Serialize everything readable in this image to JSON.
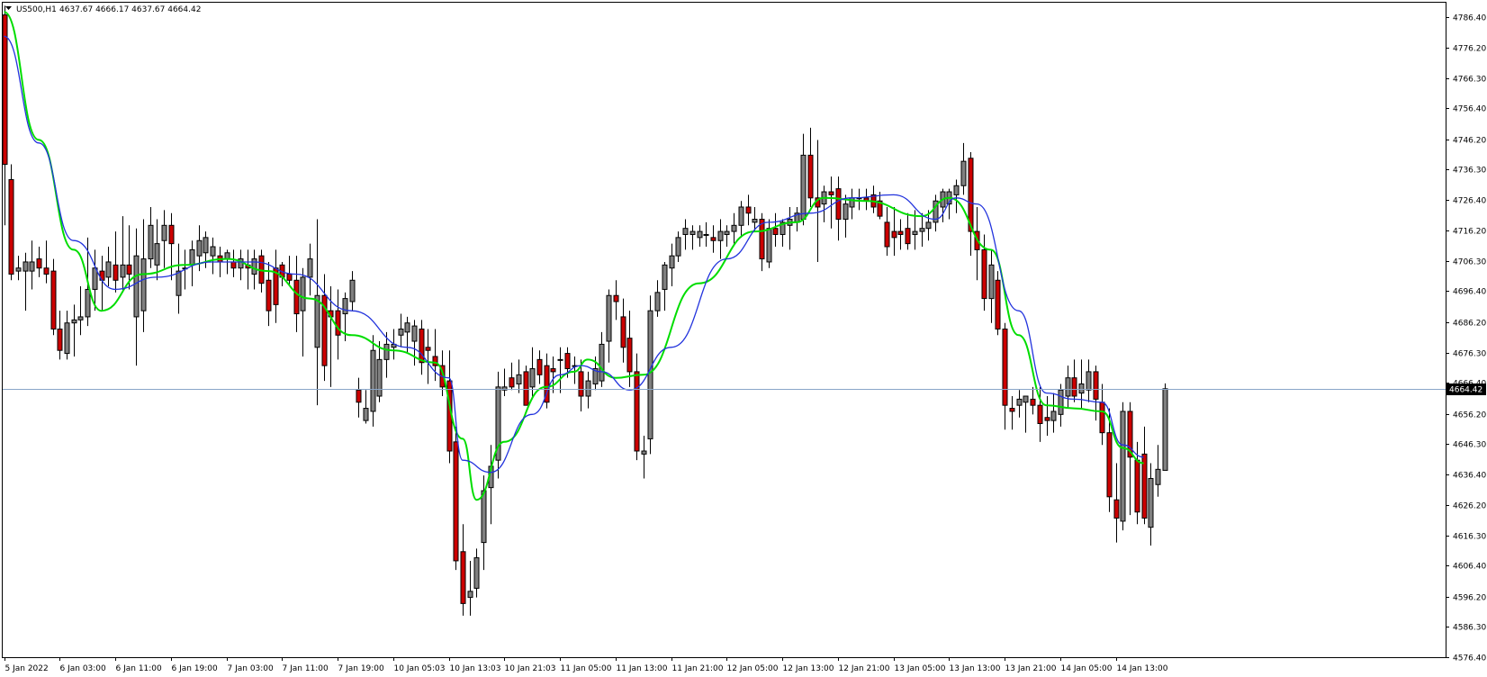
{
  "window": {
    "symbol_title": "US500,H1",
    "ohlc_text": "4637.67 4666.17 4637.67 4664.42"
  },
  "current_price_label": "4664.42",
  "colors": {
    "bull_body": "#808080",
    "bear_body": "#cc0000",
    "ma_fast": "#2233dd",
    "ma_slow": "#00dd00",
    "price_line": "#8aa6c8",
    "frame": "#000000"
  },
  "chart_data": {
    "type": "candlestick",
    "symbol": "US500",
    "timeframe": "H1",
    "ylim": [
      4576.4,
      4791.0
    ],
    "y_ticks": [
      "4786.40",
      "4776.20",
      "4766.30",
      "4756.40",
      "4746.20",
      "4736.30",
      "4726.40",
      "4716.20",
      "4706.30",
      "4696.40",
      "4686.20",
      "4676.30",
      "4666.40",
      "4656.20",
      "4646.30",
      "4636.40",
      "4626.20",
      "4616.30",
      "4606.40",
      "4596.20",
      "4586.30",
      "4576.40"
    ],
    "x_tick_labels": [
      "5 Jan 2022",
      "6 Jan 03:00",
      "6 Jan 11:00",
      "6 Jan 19:00",
      "7 Jan 03:00",
      "7 Jan 11:00",
      "7 Jan 19:00",
      "10 Jan 05:03",
      "10 Jan 13:03",
      "10 Jan 21:03",
      "11 Jan 05:00",
      "11 Jan 13:00",
      "11 Jan 21:00",
      "12 Jan 05:00",
      "12 Jan 13:00",
      "12 Jan 21:00",
      "13 Jan 05:00",
      "13 Jan 13:00",
      "13 Jan 21:00",
      "14 Jan 05:00",
      "14 Jan 13:00"
    ],
    "x_tick_bar_index": [
      0,
      8,
      16,
      24,
      32,
      40,
      48,
      56,
      64,
      72,
      80,
      88,
      96,
      104,
      112,
      120,
      128,
      136,
      144,
      152,
      160
    ],
    "current_price": 4664.42,
    "candles": [
      [
        4787,
        4790,
        4718,
        4738
      ],
      [
        4733,
        4738,
        4700,
        4702
      ],
      [
        4703,
        4708,
        4700,
        4704
      ],
      [
        4703,
        4709,
        4690,
        4706
      ],
      [
        4703,
        4713,
        4697,
        4706
      ],
      [
        4707,
        4711,
        4701,
        4704
      ],
      [
        4704,
        4713,
        4699,
        4702
      ],
      [
        4703,
        4707,
        4682,
        4684
      ],
      [
        4684,
        4690,
        4674,
        4677
      ],
      [
        4676,
        4690,
        4674,
        4686
      ],
      [
        4686,
        4692,
        4675,
        4687
      ],
      [
        4687,
        4698,
        4682,
        4688
      ],
      [
        4688,
        4714,
        4685,
        4697
      ],
      [
        4697,
        4710,
        4690,
        4704
      ],
      [
        4703,
        4708,
        4690,
        4700
      ],
      [
        4701,
        4711,
        4698,
        4706
      ],
      [
        4705,
        4716,
        4696,
        4700
      ],
      [
        4701,
        4721,
        4696,
        4705
      ],
      [
        4705,
        4718,
        4697,
        4702
      ],
      [
        4688,
        4717,
        4672,
        4708
      ],
      [
        4690,
        4720,
        4683,
        4707
      ],
      [
        4707,
        4724,
        4704,
        4718
      ],
      [
        4705,
        4720,
        4700,
        4712
      ],
      [
        4713,
        4723,
        4704,
        4718
      ],
      [
        4718,
        4722,
        4700,
        4712
      ],
      [
        4695,
        4712,
        4689,
        4703
      ],
      [
        4704,
        4710,
        4697,
        4704
      ],
      [
        4705,
        4713,
        4698,
        4710
      ],
      [
        4708,
        4718,
        4703,
        4713
      ],
      [
        4709,
        4716,
        4704,
        4714
      ],
      [
        4708,
        4714,
        4702,
        4711
      ],
      [
        4708,
        4711,
        4701,
        4706
      ],
      [
        4707,
        4710,
        4702,
        4709
      ],
      [
        4706,
        4710,
        4701,
        4704
      ],
      [
        4704,
        4710,
        4700,
        4707
      ],
      [
        4705,
        4710,
        4697,
        4704
      ],
      [
        4702,
        4710,
        4697,
        4707
      ],
      [
        4708,
        4710,
        4696,
        4699
      ],
      [
        4700,
        4706,
        4685,
        4690
      ],
      [
        4704,
        4710,
        4686,
        4692
      ],
      [
        4705,
        4706,
        4698,
        4701
      ],
      [
        4702,
        4708,
        4698,
        4700
      ],
      [
        4700,
        4708,
        4683,
        4689
      ],
      [
        4690,
        4704,
        4675,
        4701
      ],
      [
        4701,
        4712,
        4695,
        4707
      ],
      [
        4678,
        4720,
        4659,
        4695
      ],
      [
        4695,
        4702,
        4667,
        4672
      ],
      [
        4690,
        4698,
        4665,
        4688
      ],
      [
        4690,
        4697,
        4674,
        4682
      ],
      [
        4689,
        4696,
        4680,
        4694
      ],
      [
        4693,
        4703,
        4690,
        4700
      ],
      [
        4664,
        4668,
        4655,
        4660
      ],
      [
        4654,
        4664,
        4653,
        4658
      ],
      [
        4657,
        4682,
        4652,
        4677
      ],
      [
        4662,
        4680,
        4660,
        4674
      ],
      [
        4674,
        4683,
        4668,
        4679
      ],
      [
        4678,
        4684,
        4674,
        4679
      ],
      [
        4682,
        4689,
        4678,
        4684
      ],
      [
        4683,
        4688,
        4676,
        4686
      ],
      [
        4680,
        4687,
        4672,
        4685
      ],
      [
        4684,
        4687,
        4669,
        4673
      ],
      [
        4678,
        4684,
        4666,
        4677
      ],
      [
        4675,
        4684,
        4667,
        4672
      ],
      [
        4672,
        4677,
        4662,
        4665
      ],
      [
        4667,
        4677,
        4640,
        4644
      ],
      [
        4647,
        4652,
        4605,
        4608
      ],
      [
        4611,
        4620,
        4590,
        4594
      ],
      [
        4596,
        4608,
        4590,
        4598
      ],
      [
        4599,
        4612,
        4596,
        4609
      ],
      [
        4614,
        4636,
        4605,
        4631
      ],
      [
        4632,
        4646,
        4620,
        4639
      ],
      [
        4641,
        4670,
        4635,
        4665
      ],
      [
        4664,
        4671,
        4662,
        4665
      ],
      [
        4668,
        4673,
        4664,
        4665
      ],
      [
        4666,
        4674,
        4663,
        4669
      ],
      [
        4670,
        4672,
        4660,
        4659
      ],
      [
        4665,
        4678,
        4661,
        4671
      ],
      [
        4674,
        4677,
        4666,
        4669
      ],
      [
        4672,
        4676,
        4658,
        4660
      ],
      [
        4671,
        4675,
        4663,
        4670
      ],
      [
        4674,
        4678,
        4663,
        4674
      ],
      [
        4676,
        4678,
        4668,
        4671
      ],
      [
        4672,
        4675,
        4666,
        4672
      ],
      [
        4670,
        4674,
        4657,
        4662
      ],
      [
        4662,
        4670,
        4658,
        4667
      ],
      [
        4666,
        4675,
        4664,
        4671
      ],
      [
        4667,
        4683,
        4665,
        4679
      ],
      [
        4680,
        4697,
        4673,
        4695
      ],
      [
        4695,
        4700,
        4687,
        4693
      ],
      [
        4688,
        4694,
        4673,
        4678
      ],
      [
        4681,
        4690,
        4665,
        4670
      ],
      [
        4670,
        4676,
        4641,
        4644
      ],
      [
        4643,
        4649,
        4635,
        4644
      ],
      [
        4648,
        4695,
        4643,
        4690
      ],
      [
        4690,
        4700,
        4688,
        4696
      ],
      [
        4697,
        4706,
        4690,
        4705
      ],
      [
        4704,
        4712,
        4698,
        4708
      ],
      [
        4708,
        4716,
        4706,
        4714
      ],
      [
        4715,
        4720,
        4710,
        4717
      ],
      [
        4715,
        4718,
        4710,
        4716
      ],
      [
        4714,
        4718,
        4711,
        4716
      ],
      [
        4715,
        4719,
        4711,
        4715
      ],
      [
        4714,
        4718,
        4709,
        4713
      ],
      [
        4713,
        4720,
        4707,
        4716
      ],
      [
        4715,
        4718,
        4711,
        4716
      ],
      [
        4716,
        4722,
        4712,
        4718
      ],
      [
        4718,
        4726,
        4714,
        4724
      ],
      [
        4724,
        4728,
        4718,
        4722
      ],
      [
        4719,
        4724,
        4716,
        4720
      ],
      [
        4720,
        4722,
        4703,
        4707
      ],
      [
        4706,
        4720,
        4704,
        4717
      ],
      [
        4717,
        4722,
        4711,
        4715
      ],
      [
        4715,
        4720,
        4711,
        4719
      ],
      [
        4718,
        4724,
        4710,
        4720
      ],
      [
        4719,
        4724,
        4716,
        4722
      ],
      [
        4720,
        4748,
        4718,
        4741
      ],
      [
        4741,
        4750,
        4724,
        4727
      ],
      [
        4727,
        4746,
        4706,
        4724
      ],
      [
        4725,
        4731,
        4719,
        4729
      ],
      [
        4729,
        4734,
        4717,
        4728
      ],
      [
        4730,
        4734,
        4713,
        4720
      ],
      [
        4720,
        4728,
        4714,
        4725
      ],
      [
        4724,
        4730,
        4720,
        4727
      ],
      [
        4727,
        4730,
        4723,
        4727
      ],
      [
        4727,
        4730,
        4723,
        4726
      ],
      [
        4728,
        4731,
        4722,
        4724
      ],
      [
        4726,
        4729,
        4720,
        4721
      ],
      [
        4719,
        4724,
        4708,
        4711
      ],
      [
        4716,
        4724,
        4708,
        4714
      ],
      [
        4716,
        4720,
        4710,
        4715
      ],
      [
        4717,
        4722,
        4710,
        4712
      ],
      [
        4715,
        4723,
        4710,
        4716
      ],
      [
        4716,
        4722,
        4711,
        4717
      ],
      [
        4717,
        4723,
        4713,
        4719
      ],
      [
        4719,
        4728,
        4716,
        4726
      ],
      [
        4724,
        4730,
        4719,
        4729
      ],
      [
        4725,
        4730,
        4720,
        4729
      ],
      [
        4728,
        4733,
        4722,
        4731
      ],
      [
        4731,
        4745,
        4728,
        4739
      ],
      [
        4740,
        4742,
        4708,
        4716
      ],
      [
        4716,
        4724,
        4700,
        4710
      ],
      [
        4710,
        4715,
        4690,
        4694
      ],
      [
        4694,
        4710,
        4686,
        4705
      ],
      [
        4700,
        4703,
        4682,
        4684
      ],
      [
        4684,
        4686,
        4651,
        4659
      ],
      [
        4658,
        4662,
        4651,
        4657
      ],
      [
        4659,
        4664,
        4655,
        4661
      ],
      [
        4660,
        4662,
        4650,
        4662
      ],
      [
        4661,
        4665,
        4656,
        4659
      ],
      [
        4659,
        4665,
        4647,
        4653
      ],
      [
        4655,
        4662,
        4649,
        4654
      ],
      [
        4654,
        4663,
        4650,
        4657
      ],
      [
        4656,
        4666,
        4652,
        4664
      ],
      [
        4662,
        4672,
        4658,
        4668
      ],
      [
        4668,
        4674,
        4660,
        4662
      ],
      [
        4663,
        4674,
        4658,
        4666
      ],
      [
        4664,
        4674,
        4660,
        4670
      ],
      [
        4670,
        4672,
        4654,
        4661
      ],
      [
        4660,
        4666,
        4646,
        4650
      ],
      [
        4650,
        4658,
        4624,
        4629
      ],
      [
        4628,
        4640,
        4614,
        4622
      ],
      [
        4621,
        4660,
        4618,
        4657
      ],
      [
        4657,
        4660,
        4623,
        4642
      ],
      [
        4641,
        4647,
        4620,
        4624
      ],
      [
        4643,
        4652,
        4620,
        4622
      ],
      [
        4619,
        4640,
        4613,
        4635
      ],
      [
        4633,
        4646,
        4629,
        4638
      ],
      [
        4637.67,
        4666.17,
        4637.67,
        4664.42
      ]
    ],
    "ma_fast_x": [
      0,
      5,
      10,
      16,
      22,
      30,
      36,
      42,
      50,
      58,
      64,
      66,
      70,
      76,
      80,
      83,
      86,
      90,
      96,
      104,
      110,
      116,
      122,
      128,
      134,
      137,
      140,
      146,
      150,
      154,
      158,
      161,
      164
    ],
    "ma_fast_y": [
      4780,
      4745,
      4713,
      4697,
      4701,
      4706,
      4706,
      4702,
      4690,
      4678,
      4668,
      4641,
      4637,
      4656,
      4669,
      4672,
      4670,
      4664,
      4678,
      4707,
      4719,
      4722,
      4727,
      4728,
      4720,
      4727,
      4725,
      4690,
      4663,
      4661,
      4660,
      4646,
      4642
    ],
    "ma_slow_x": [
      0,
      5,
      10,
      14,
      20,
      26,
      32,
      38,
      44,
      50,
      56,
      62,
      66,
      68,
      72,
      78,
      82,
      84,
      88,
      92,
      100,
      108,
      114,
      118,
      124,
      132,
      136,
      142,
      146,
      150,
      154,
      158,
      161,
      164
    ],
    "ma_slow_y": [
      4788,
      4746,
      4710,
      4690,
      4702,
      4705,
      4707,
      4703,
      4694,
      4682,
      4677,
      4673,
      4648,
      4628,
      4647,
      4665,
      4670,
      4674,
      4668,
      4669,
      4699,
      4716,
      4719,
      4727,
      4726,
      4721,
      4727,
      4710,
      4682,
      4659,
      4658,
      4657,
      4645,
      4640
    ]
  }
}
